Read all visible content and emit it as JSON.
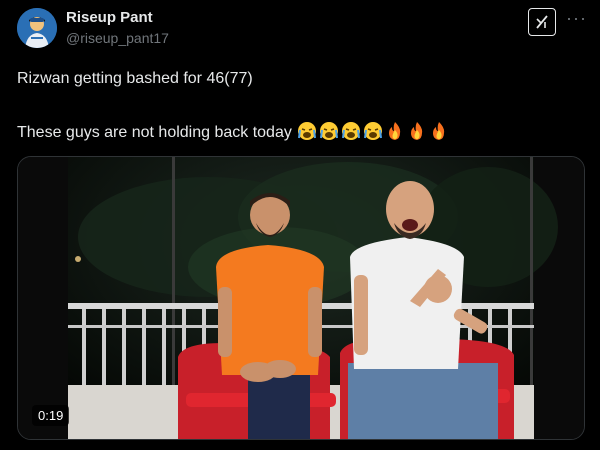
{
  "user": {
    "display_name": "Riseup Pant",
    "handle": "@riseup_pant17"
  },
  "tweet": {
    "line1": "Rizwan getting bashed for 46(77)",
    "line2": "These guys are not holding back today",
    "emojis": [
      "crying-face-emoji",
      "crying-face-emoji",
      "crying-face-emoji",
      "crying-face-emoji",
      "fire-emoji",
      "fire-emoji",
      "fire-emoji"
    ]
  },
  "media": {
    "type": "video",
    "duration": "0:19"
  },
  "colors": {
    "background": "#000000",
    "text": "#e7e9ea",
    "secondary_text": "#71767b",
    "orange_shirt": "#f47a1f",
    "chair_red": "#d4232a"
  }
}
